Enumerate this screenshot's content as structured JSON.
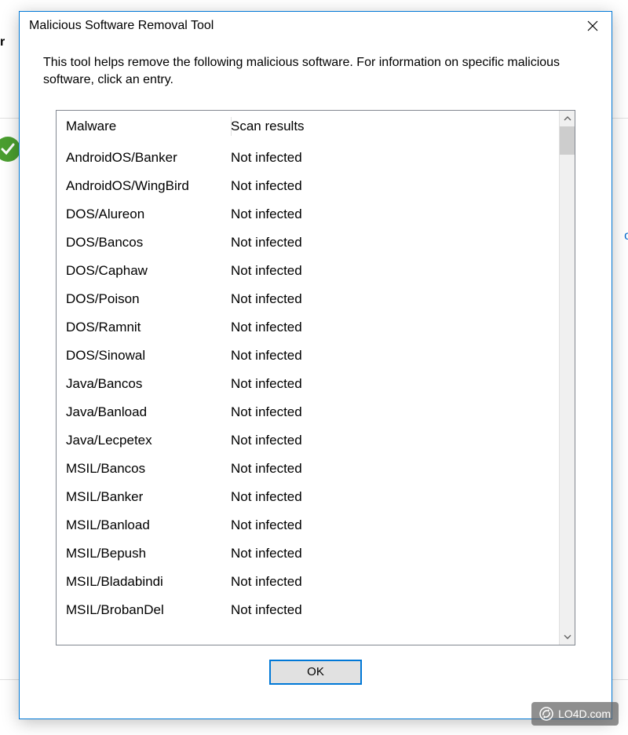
{
  "backdrop": {
    "partial_text": "r",
    "partial_letter": "o"
  },
  "dialog": {
    "title": "Malicious Software Removal Tool",
    "description": "This tool helps remove the following malicious software. For information on specific malicious software, click an entry.",
    "columns": {
      "malware": "Malware",
      "results": "Scan results"
    },
    "rows": [
      {
        "name": "AndroidOS/Banker",
        "result": "Not infected"
      },
      {
        "name": "AndroidOS/WingBird",
        "result": "Not infected"
      },
      {
        "name": "DOS/Alureon",
        "result": "Not infected"
      },
      {
        "name": "DOS/Bancos",
        "result": "Not infected"
      },
      {
        "name": "DOS/Caphaw",
        "result": "Not infected"
      },
      {
        "name": "DOS/Poison",
        "result": "Not infected"
      },
      {
        "name": "DOS/Ramnit",
        "result": "Not infected"
      },
      {
        "name": "DOS/Sinowal",
        "result": "Not infected"
      },
      {
        "name": "Java/Bancos",
        "result": "Not infected"
      },
      {
        "name": "Java/Banload",
        "result": "Not infected"
      },
      {
        "name": "Java/Lecpetex",
        "result": "Not infected"
      },
      {
        "name": "MSIL/Bancos",
        "result": "Not infected"
      },
      {
        "name": "MSIL/Banker",
        "result": "Not infected"
      },
      {
        "name": "MSIL/Banload",
        "result": "Not infected"
      },
      {
        "name": "MSIL/Bepush",
        "result": "Not infected"
      },
      {
        "name": "MSIL/Bladabindi",
        "result": "Not infected"
      },
      {
        "name": "MSIL/BrobanDel",
        "result": "Not infected"
      }
    ],
    "ok_label": "OK"
  },
  "watermark": {
    "text": "LO4D.com"
  }
}
